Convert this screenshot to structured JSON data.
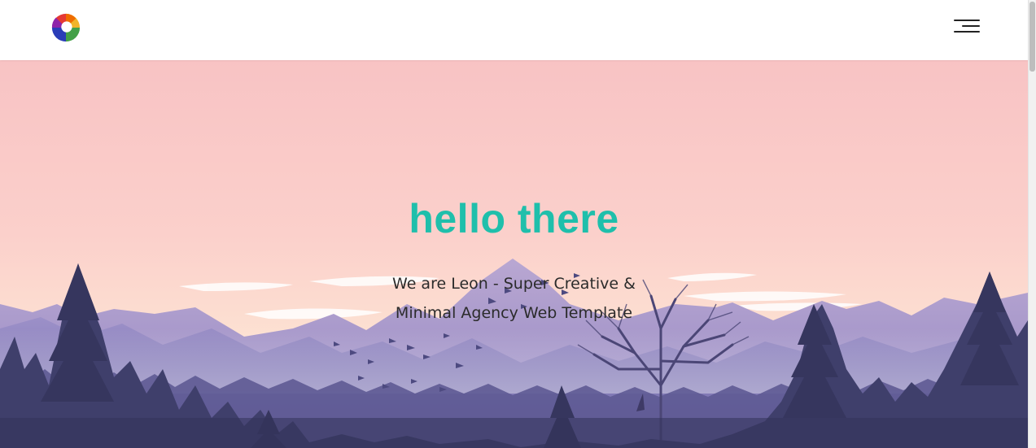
{
  "header": {
    "logo_icon": "color-swirl-logo-icon",
    "menu_icon": "hamburger-menu-icon"
  },
  "hero": {
    "title": "hello there",
    "subtitle": "We are Leon - Super Creative & Minimal Agency Web Template",
    "background": "pink-sunset-mountain-forest-illustration"
  },
  "colors": {
    "accent": "#1fbfab",
    "sky_top": "#f8c3c4",
    "sky_bottom": "#fde3d3",
    "mountain": "#8d7fb8",
    "forest": "#3f3f6b"
  }
}
